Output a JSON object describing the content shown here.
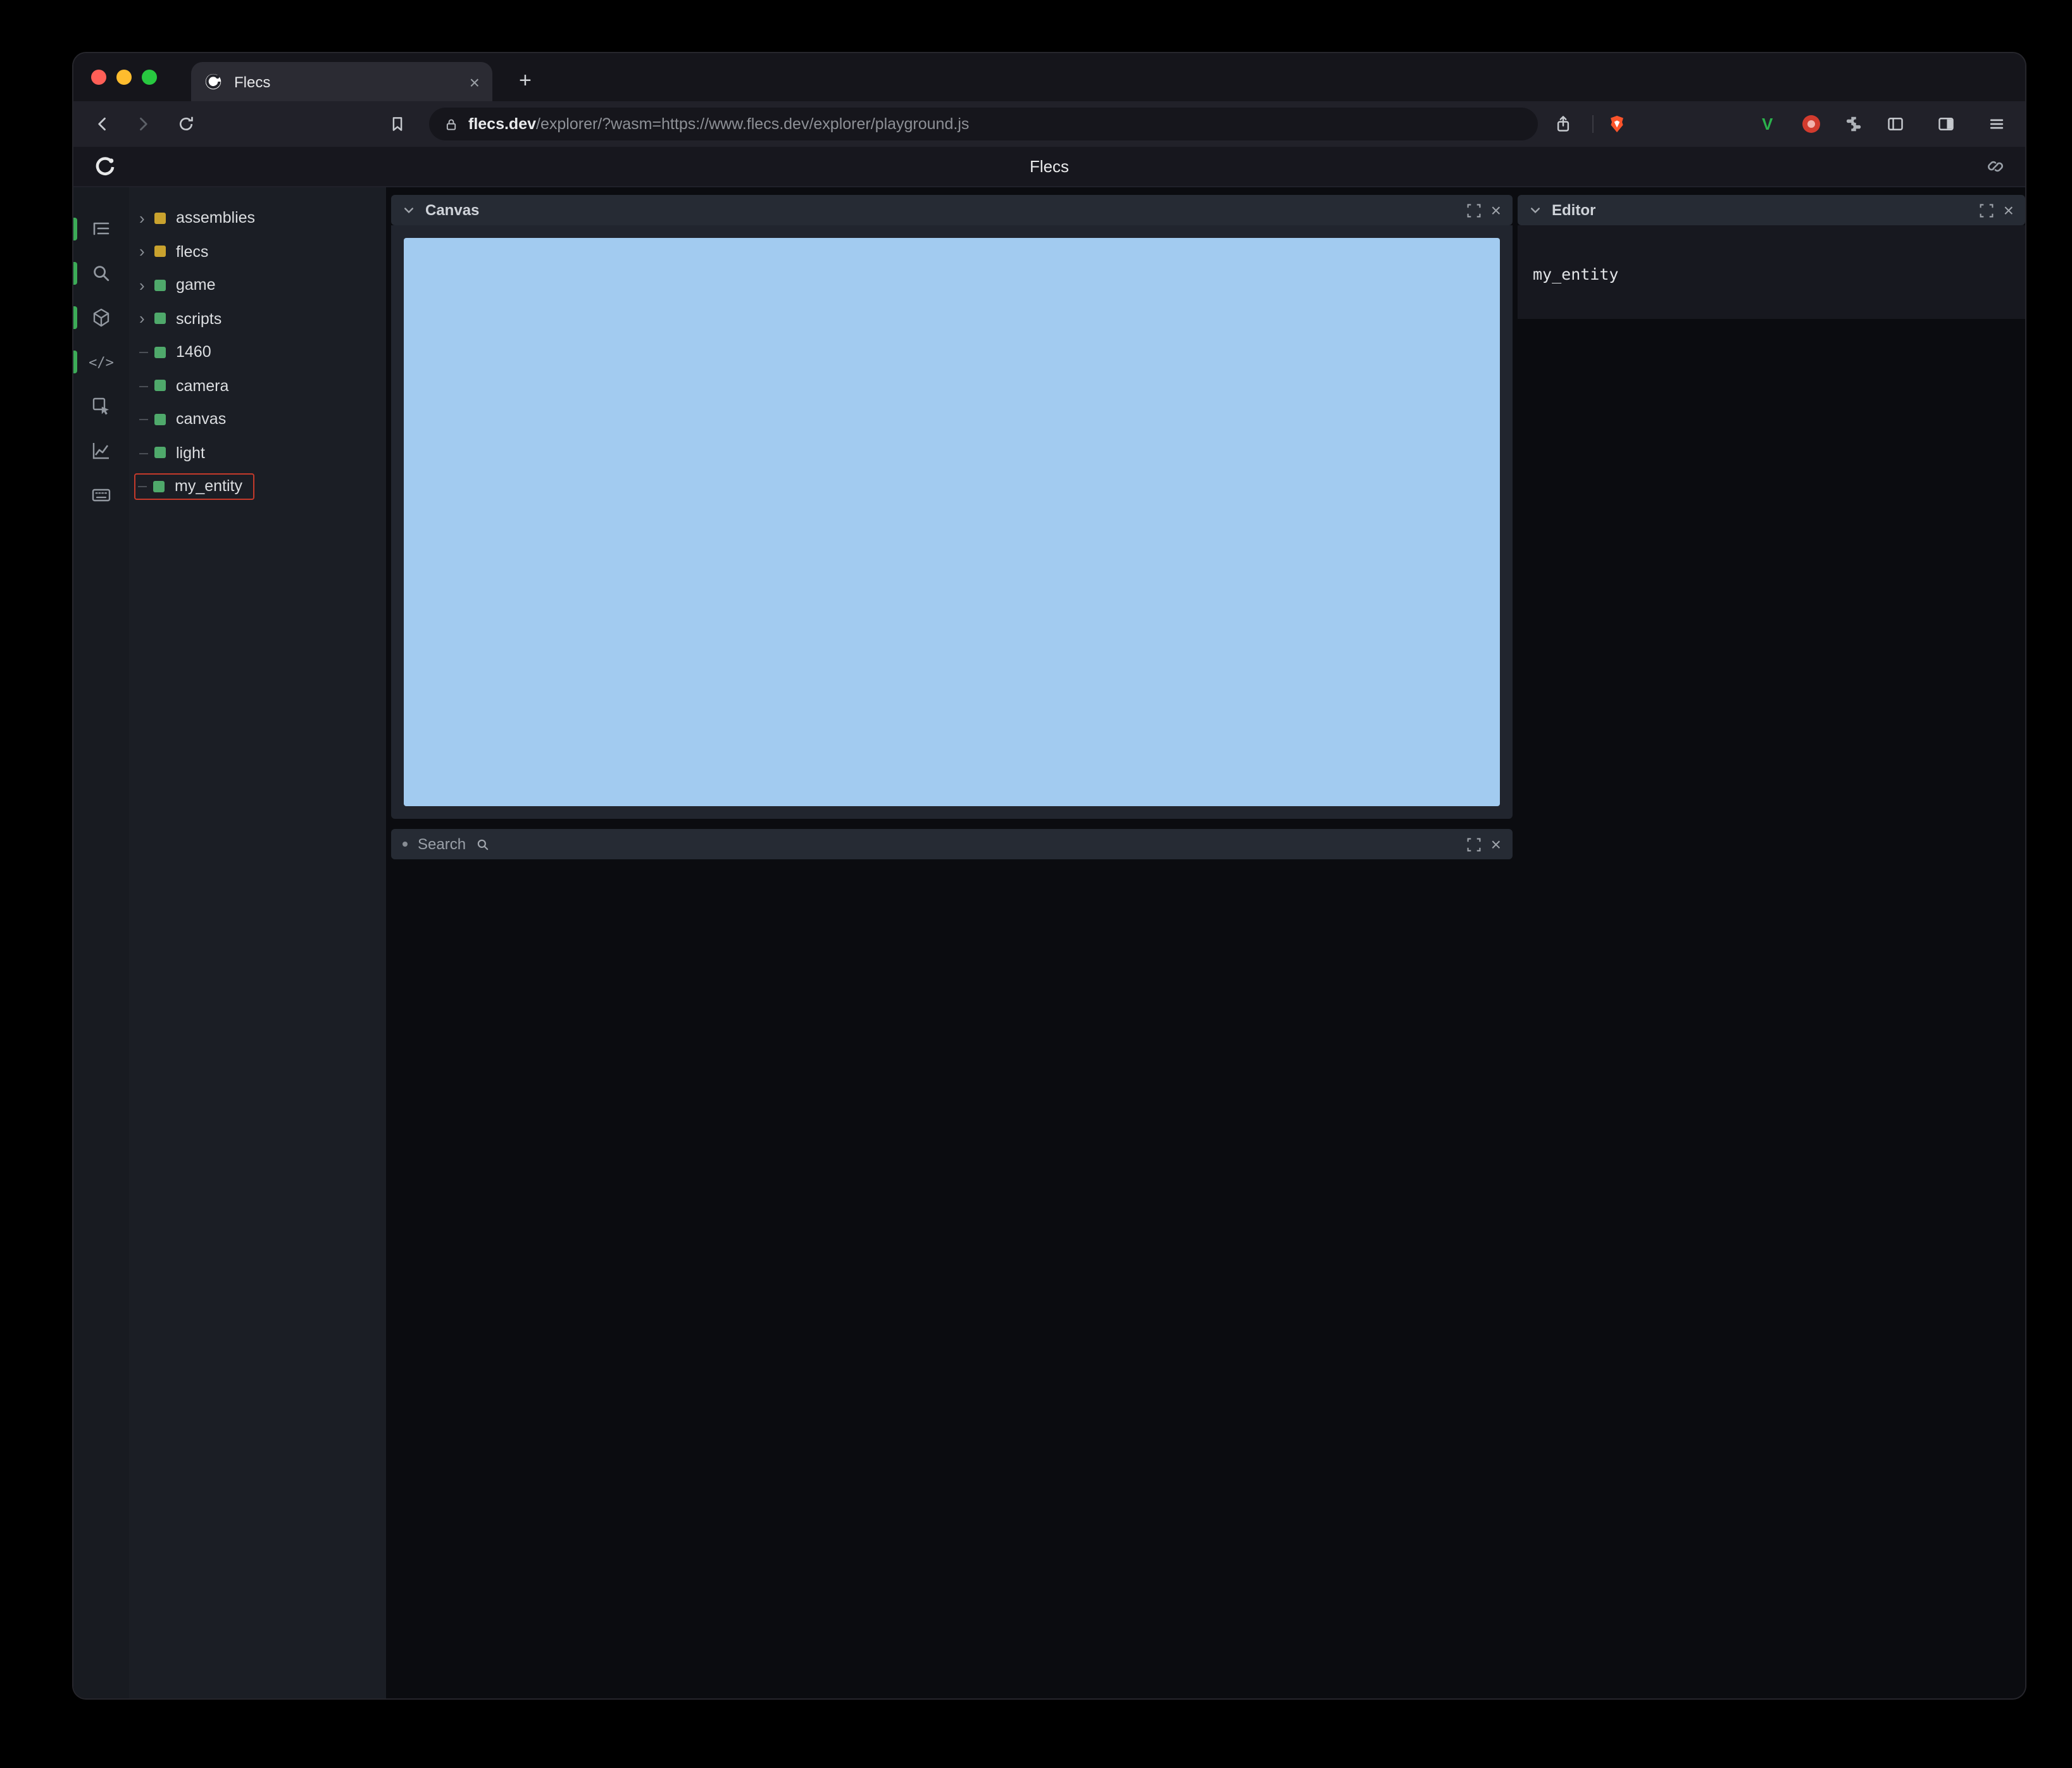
{
  "browser": {
    "tab_title": "Flecs",
    "url_domain": "flecs.dev",
    "url_path": "/explorer/?wasm=https://www.flecs.dev/explorer/playground.js"
  },
  "icons": {
    "chevron_right_glyph": "›",
    "close_glyph": "×",
    "bullet_glyph": "•",
    "plus_glyph": "+",
    "code_glyph": "</>",
    "v_extension_glyph": "V"
  },
  "app": {
    "title": "Flecs",
    "tree": {
      "items": [
        {
          "label": "assemblies",
          "color": "#c9a22e",
          "expandable": true
        },
        {
          "label": "flecs",
          "color": "#c9a22e",
          "expandable": true
        },
        {
          "label": "game",
          "color": "#4fa96b",
          "expandable": true
        },
        {
          "label": "scripts",
          "color": "#4fa96b",
          "expandable": true
        },
        {
          "label": "1460",
          "color": "#4fa96b",
          "expandable": false
        },
        {
          "label": "camera",
          "color": "#4fa96b",
          "expandable": false
        },
        {
          "label": "canvas",
          "color": "#4fa96b",
          "expandable": false
        },
        {
          "label": "light",
          "color": "#4fa96b",
          "expandable": false
        },
        {
          "label": "my_entity",
          "color": "#4fa96b",
          "expandable": false,
          "highlighted": true
        }
      ]
    },
    "canvas_panel": {
      "title": "Canvas"
    },
    "search_panel": {
      "title": "Search"
    },
    "editor_panel": {
      "title": "Editor",
      "content": "my_entity"
    },
    "colors": {
      "canvas_blue": "#a2cbf0",
      "highlight_red": "#c43a2b",
      "entity_green": "#4fa96b",
      "module_yellow": "#c9a22e"
    }
  }
}
